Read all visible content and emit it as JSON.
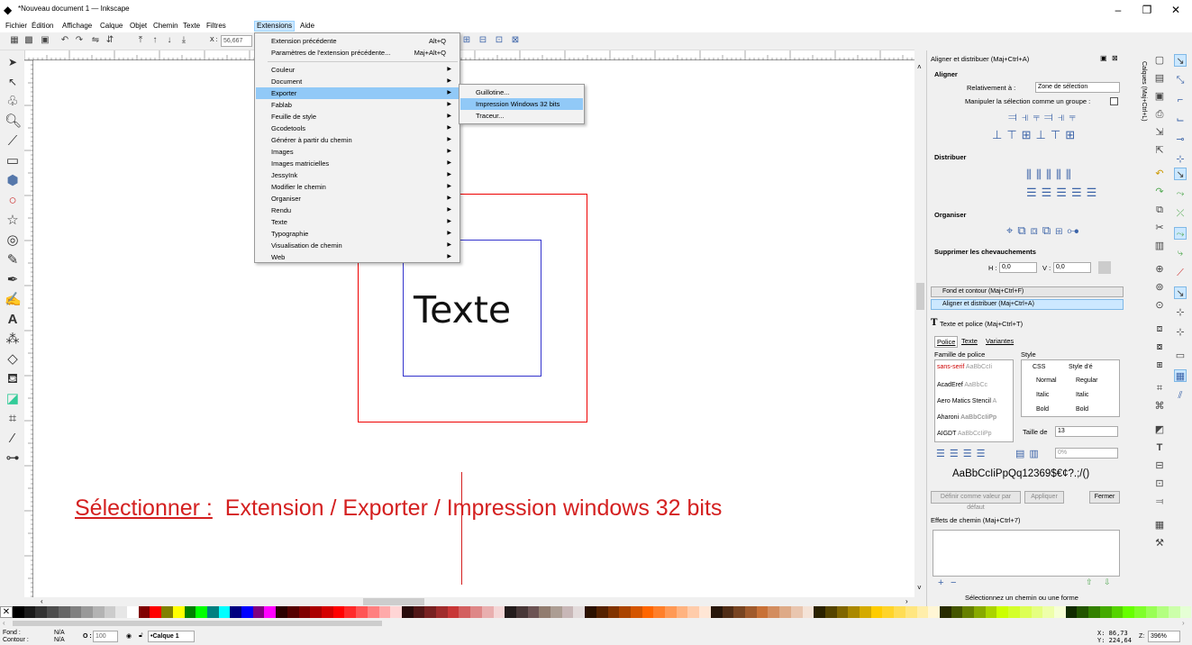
{
  "window": {
    "title": "*Nouveau document 1 — Inkscape",
    "minimize": "–",
    "maximize": "❐",
    "close": "✕"
  },
  "menubar": [
    "Fichier",
    "Édition",
    "Affichage",
    "Calque",
    "Objet",
    "Chemin",
    "Texte",
    "Filtres",
    "Extensions",
    "Aide"
  ],
  "toolbar": {
    "x_label": "X :",
    "x_value": "56,667"
  },
  "extensions_menu": {
    "items": [
      {
        "label": "Extension précédente",
        "shortcut": "Alt+Q"
      },
      {
        "label": "Paramètres de l'extension précédente...",
        "shortcut": "Maj+Alt+Q"
      }
    ],
    "submenus": [
      "Couleur",
      "Document",
      "Exporter",
      "Fablab",
      "Feuille de style",
      "Gcodetools",
      "Générer à partir du chemin",
      "Images",
      "Images matricielles",
      "JessyInk",
      "Modifier le chemin",
      "Organiser",
      "Rendu",
      "Texte",
      "Typographie",
      "Visualisation de chemin",
      "Web"
    ],
    "highlighted": "Exporter"
  },
  "exporter_submenu": {
    "items": [
      "Guillotine...",
      "Impression Windows 32 bits",
      "Traceur..."
    ],
    "highlighted": "Impression Windows 32 bits"
  },
  "canvas": {
    "text": "Texte",
    "annotation_prefix": "Sélectionner :",
    "annotation_text": "Extension / Exporter / Impression windows 32 bits"
  },
  "align_panel": {
    "title": "Aligner et distribuer (Maj+Ctrl+A)",
    "section_align": "Aligner",
    "relative_label": "Relativement à :",
    "relative_value": "Zone de sélection",
    "group_label": "Manipuler la sélection comme un groupe :",
    "section_distribute": "Distribuer",
    "section_organize": "Organiser",
    "section_overlap": "Supprimer les chevauchements",
    "h_label": "H :",
    "h_value": "0,0",
    "v_label": "V :",
    "v_value": "0,0"
  },
  "collapsed_panels": {
    "fill_stroke": "Fond et contour (Maj+Ctrl+F)",
    "align": "Aligner et distribuer (Maj+Ctrl+A)"
  },
  "text_panel": {
    "title": "Texte et police (Maj+Ctrl+T)",
    "tabs": [
      "Police",
      "Texte",
      "Variantes"
    ],
    "family_label": "Famille de police",
    "style_label": "Style",
    "fonts": [
      {
        "name": "sans-serif",
        "sample": "AaBbCcIi"
      },
      {
        "name": "AcadEref",
        "sample": "AaBbCc"
      },
      {
        "name": "Aero Matics Stencil",
        "sample": "A"
      },
      {
        "name": "Aharoni",
        "sample": "AaBbCcIiPp"
      },
      {
        "name": "AIGDT",
        "sample": "AaBbCcIiPp"
      }
    ],
    "style_headers": [
      "CSS",
      "Style d'é"
    ],
    "styles": [
      [
        "Normal",
        "Regular"
      ],
      [
        "Italic",
        "Italic"
      ],
      [
        "Bold",
        "Bold"
      ]
    ],
    "size_label": "Taille de",
    "size_value": "13",
    "spacing_value": "0%",
    "preview": "AaBbCcIiPpQq12369$€¢?.;/()",
    "btn_default": "Définir comme valeur par défaut",
    "btn_apply": "Appliquer",
    "btn_close": "Fermer"
  },
  "path_effects": {
    "title": "Effets de chemin (Maj+Ctrl+7)",
    "hint": "Sélectionnez un chemin ou une forme"
  },
  "layers_tab": "Calques (Maj+Ctrl+L)",
  "statusbar": {
    "fill_label": "Fond :",
    "fill_value": "N/A",
    "stroke_label": "Contour :",
    "stroke_value": "N/A",
    "opacity_label": "O :",
    "opacity_value": "100",
    "layer": "•Calque 1",
    "x_coord": "X:  86,73",
    "y_coord": "Y: 224,64",
    "zoom_label": "Z:",
    "zoom_value": "396%"
  },
  "palette_colors": [
    "#000000",
    "#1a1a1a",
    "#333333",
    "#4d4d4d",
    "#666666",
    "#808080",
    "#999999",
    "#b3b3b3",
    "#cccccc",
    "#e6e6e6",
    "#ffffff",
    "#800000",
    "#ff0000",
    "#808000",
    "#ffff00",
    "#008000",
    "#00ff00",
    "#008080",
    "#00ffff",
    "#000080",
    "#0000ff",
    "#800080",
    "#ff00ff",
    "#2b0000",
    "#550000",
    "#800000",
    "#aa0000",
    "#d40000",
    "#ff0000",
    "#ff2a2a",
    "#ff5555",
    "#ff8080",
    "#ffaaaa",
    "#ffd5d5",
    "#280b0b",
    "#501616",
    "#782121",
    "#a02c2c",
    "#c83737",
    "#d35f5f",
    "#de8787",
    "#e9afaf",
    "#f4d7d7",
    "#241c1c",
    "#483737",
    "#6c5353",
    "#917c6f",
    "#ac9d93",
    "#c8b7b7",
    "#e3dbdb",
    "#2b1100",
    "#552200",
    "#803300",
    "#aa4400",
    "#d45500",
    "#ff6600",
    "#ff7f2a",
    "#ff9955",
    "#ffb380",
    "#ffccaa",
    "#ffe6d5",
    "#28170b",
    "#502d16",
    "#784421",
    "#a05a2c",
    "#c87137",
    "#d38d5f",
    "#deaa87",
    "#e9c6af",
    "#f4e3d7",
    "#2b2200",
    "#554400",
    "#806600",
    "#aa8800",
    "#d4aa00",
    "#ffcc00",
    "#ffd42a",
    "#ffdd55",
    "#ffe680",
    "#ffeeaa",
    "#fff6d5",
    "#282b00",
    "#445500",
    "#668000",
    "#88aa00",
    "#aad400",
    "#ccff00",
    "#d4ff2a",
    "#ddff55",
    "#e5ff80",
    "#eeffaa",
    "#f6ffd5",
    "#112b00",
    "#225500",
    "#338000",
    "#44aa00",
    "#55d400",
    "#66ff00",
    "#7fff2a",
    "#99ff55",
    "#b3ff80",
    "#ccffaa",
    "#e5ffd5"
  ]
}
